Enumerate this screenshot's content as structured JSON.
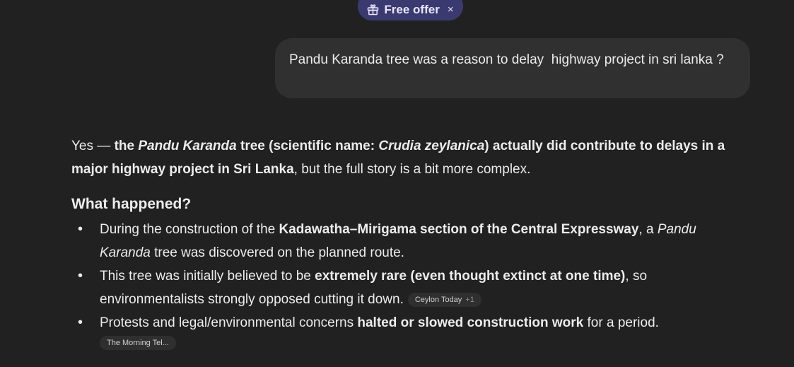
{
  "offer": {
    "label": "Free offer",
    "close": "×",
    "icon": "gift-icon"
  },
  "user_message": "Pandu Karanda tree was a reason to delay  highway project in sri lanka ?",
  "answer": {
    "intro": {
      "p1": "Yes — ",
      "b1": "the ",
      "bi1": "Pandu Karanda",
      "b2": " tree (scientific name: ",
      "bi2": "Crudia zeylanica",
      "b3": ") actually did contribute to delays in a major highway project in Sri Lanka",
      "p2": ", but the full story is a bit more complex."
    },
    "heading": "What happened?",
    "bullets": [
      {
        "t1": "During the construction of the ",
        "b1": "Kadawatha–Mirigama section of the Central Expressway",
        "t2": ", a ",
        "i1": "Pandu Karanda",
        "t3": " tree was discovered on the planned route."
      },
      {
        "t1": "This tree was initially believed to be ",
        "b1": "extremely rare (even thought extinct at one time)",
        "t2": ", so environmentalists strongly opposed cutting it down.",
        "cite": "Ceylon Today",
        "cite_extra": "+1"
      },
      {
        "t1": "Protests and legal/environmental concerns ",
        "b1": "halted or slowed construction work",
        "t2": " for a period.",
        "cite": "The Morning Tel..."
      }
    ]
  }
}
